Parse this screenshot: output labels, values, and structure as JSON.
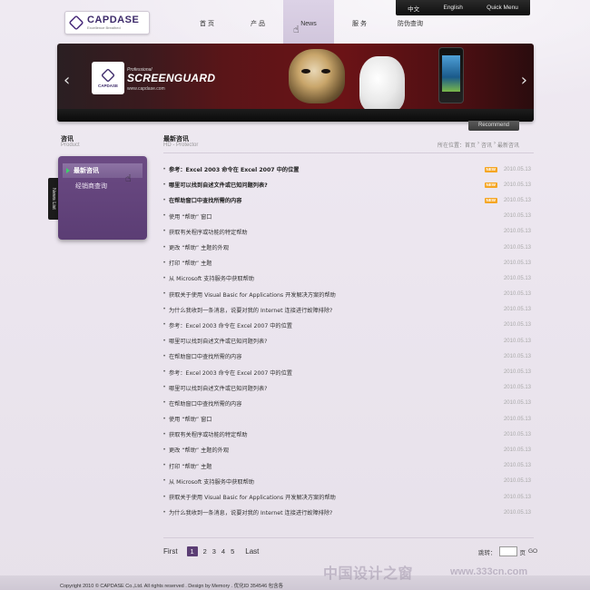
{
  "topbar": {
    "items": [
      "中文",
      "English",
      "Quick Menu"
    ]
  },
  "logo": {
    "name": "CAPDASE",
    "tagline": "Excellence Breathed"
  },
  "nav": {
    "items": [
      "首 页",
      "产 品",
      "News",
      "服 务",
      "防伪查询"
    ],
    "active_index": 2
  },
  "banner": {
    "logo_name": "CAPDASE",
    "prefix": "Professional",
    "title": "SCREENGUARD",
    "url": "www.capdase.com",
    "prev_arrow": "‹",
    "next_arrow": "›"
  },
  "recommend_label": "Recommend",
  "sidebar": {
    "title": "咨讯",
    "subtitle": "Product",
    "items": [
      "最新咨讯",
      "经销商查询"
    ],
    "active_index": 0,
    "tab_label": "News List"
  },
  "main": {
    "title": "最新咨讯",
    "subtitle": "HD - Protector",
    "breadcrumb": [
      "所在位置：首页",
      "›",
      "咨讯",
      "›",
      "最新咨讯"
    ],
    "new_badge": "NEW",
    "news": [
      {
        "title": "参考：Excel 2003 命令在 Excel 2007 中的位置",
        "date": "2010.05.13",
        "bold": true,
        "new": true
      },
      {
        "title": "哪里可以找到自述文件或已知问题列表?",
        "date": "2010.05.13",
        "bold": true,
        "new": true
      },
      {
        "title": "在帮助窗口中查找所需的内容",
        "date": "2010.05.13",
        "bold": true,
        "new": true
      },
      {
        "title": "使用 “帮助” 窗口",
        "date": "2010.05.13",
        "bold": false,
        "new": false
      },
      {
        "title": "获取有关程序或功能的特定帮助",
        "date": "2010.05.13",
        "bold": false,
        "new": false
      },
      {
        "title": "更改 “帮助” 主题的外观",
        "date": "2010.05.13",
        "bold": false,
        "new": false
      },
      {
        "title": "打印 “帮助” 主题",
        "date": "2010.05.13",
        "bold": false,
        "new": false
      },
      {
        "title": "从 Microsoft 支持服务中获取帮助",
        "date": "2010.05.13",
        "bold": false,
        "new": false
      },
      {
        "title": "获取关于使用 Visual Basic for Applications 开发解决方案的帮助",
        "date": "2010.05.13",
        "bold": false,
        "new": false
      },
      {
        "title": "为什么我收到一条消息，说要对我的 Internet 连接进行故障排除?",
        "date": "2010.05.13",
        "bold": false,
        "new": false
      },
      {
        "title": "参考：Excel 2003 命令在 Excel 2007 中的位置",
        "date": "2010.05.13",
        "bold": false,
        "new": false
      },
      {
        "title": "哪里可以找到自述文件或已知问题列表?",
        "date": "2010.05.13",
        "bold": false,
        "new": false
      },
      {
        "title": "在帮助窗口中查找所需的内容",
        "date": "2010.05.13",
        "bold": false,
        "new": false
      },
      {
        "title": "参考：Excel 2003 命令在 Excel 2007 中的位置",
        "date": "2010.05.13",
        "bold": false,
        "new": false
      },
      {
        "title": "哪里可以找到自述文件或已知问题列表?",
        "date": "2010.05.13",
        "bold": false,
        "new": false
      },
      {
        "title": "在帮助窗口中查找所需的内容",
        "date": "2010.05.13",
        "bold": false,
        "new": false
      },
      {
        "title": "使用 “帮助” 窗口",
        "date": "2010.05.13",
        "bold": false,
        "new": false
      },
      {
        "title": "获取有关程序或功能的特定帮助",
        "date": "2010.05.13",
        "bold": false,
        "new": false
      },
      {
        "title": "更改 “帮助” 主题的外观",
        "date": "2010.05.13",
        "bold": false,
        "new": false
      },
      {
        "title": "打印 “帮助” 主题",
        "date": "2010.05.13",
        "bold": false,
        "new": false
      },
      {
        "title": "从 Microsoft 支持服务中获取帮助",
        "date": "2010.05.13",
        "bold": false,
        "new": false
      },
      {
        "title": "获取关于使用 Visual Basic for Applications 开发解决方案的帮助",
        "date": "2010.05.13",
        "bold": false,
        "new": false
      },
      {
        "title": "为什么我收到一条消息，说要对我的 Internet 连接进行故障排除?",
        "date": "2010.05.13",
        "bold": false,
        "new": false
      }
    ]
  },
  "pagination": {
    "first": "First",
    "pages": [
      "1",
      "2",
      "3",
      "4",
      "5"
    ],
    "active_index": 0,
    "last": "Last"
  },
  "jump": {
    "label": "跳转：",
    "unit": "页",
    "go": "GO",
    "value": ""
  },
  "footer": {
    "text": "Copyright 2010 © CAPDASE Co.,Ltd. All rights reserved . Design by Memory . 优化ID 354546 包含各"
  },
  "watermark": {
    "text": "中国设计之窗",
    "url": "www.333cn.com"
  }
}
